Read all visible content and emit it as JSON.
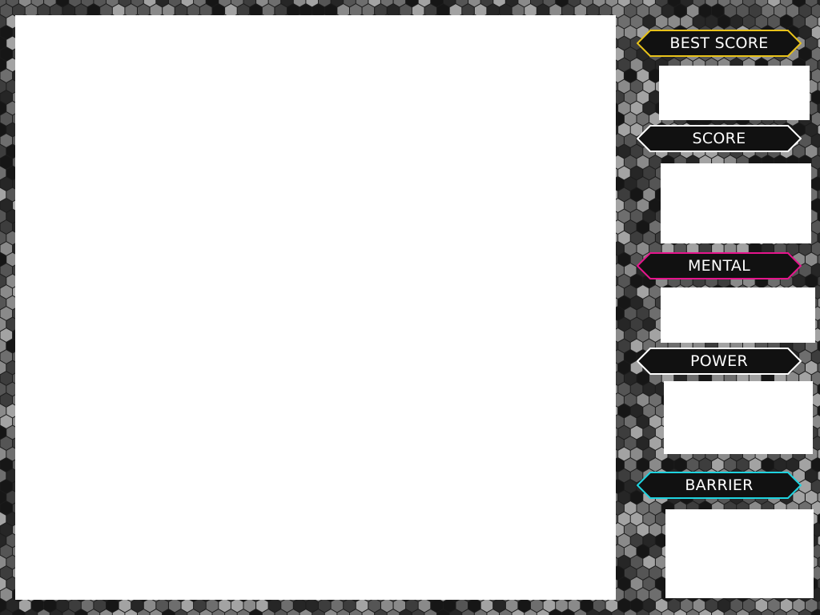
{
  "colors": {
    "background_dark": "#1c1c1c",
    "hex_shades": [
      "#161616",
      "#262626",
      "#3d3d3d",
      "#555555",
      "#6e6e6e",
      "#8a8a8a",
      "#a3a3a3"
    ],
    "panel_fill": "#ffffff",
    "label_fill": "#111111",
    "label_text": "#ffffff"
  },
  "hud": {
    "best_score": {
      "label": "BEST SCORE",
      "accent": "#e8c21a"
    },
    "score": {
      "label": "SCORE",
      "accent": "#ffffff"
    },
    "mental": {
      "label": "MENTAL",
      "accent": "#e5158c"
    },
    "power": {
      "label": "POWER",
      "accent": "#ffffff"
    },
    "barrier": {
      "label": "BARRIER",
      "accent": "#1fd3df"
    }
  }
}
